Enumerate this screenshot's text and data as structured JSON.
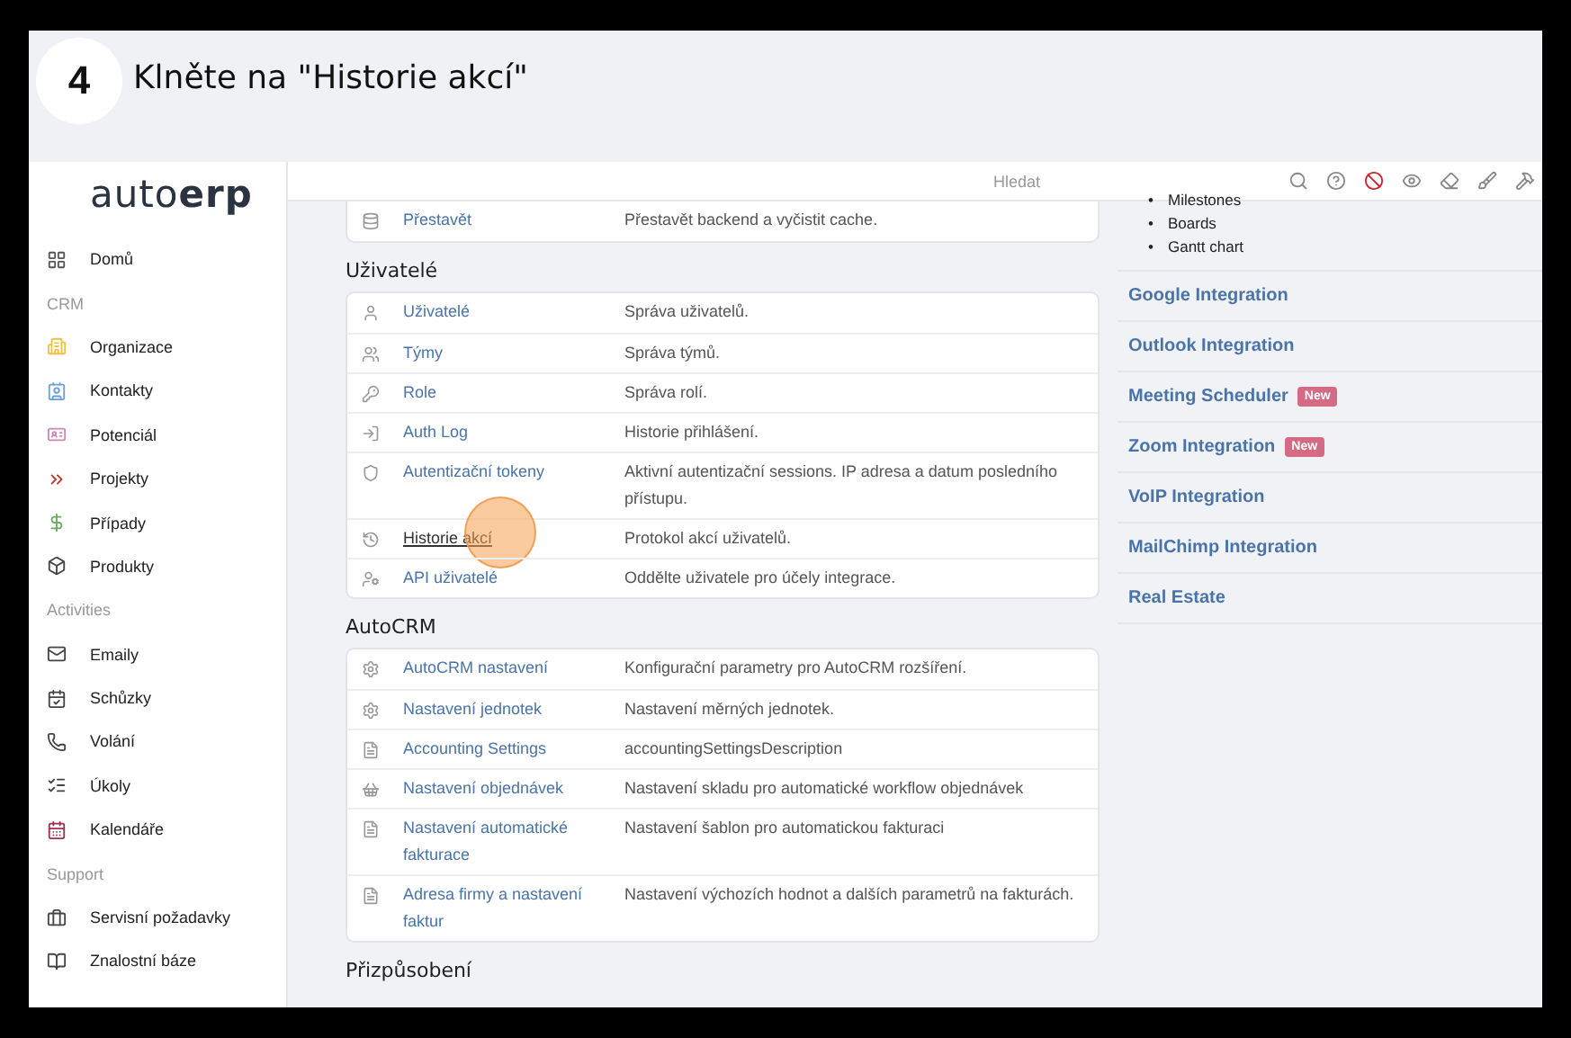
{
  "banner": {
    "step": "4",
    "title": "Klněte na \"Historie akcí\""
  },
  "sidebar": {
    "logo": {
      "light": "auto",
      "bold": "erp"
    },
    "items": [
      {
        "kind": "item",
        "label": "Domů"
      },
      {
        "kind": "section",
        "label": "CRM"
      },
      {
        "kind": "item",
        "label": "Organizace"
      },
      {
        "kind": "item",
        "label": "Kontakty"
      },
      {
        "kind": "item",
        "label": "Potenciál"
      },
      {
        "kind": "item",
        "label": "Projekty"
      },
      {
        "kind": "item",
        "label": "Případy"
      },
      {
        "kind": "item",
        "label": "Produkty"
      },
      {
        "kind": "section",
        "label": "Activities"
      },
      {
        "kind": "item",
        "label": "Emaily"
      },
      {
        "kind": "item",
        "label": "Schůzky"
      },
      {
        "kind": "item",
        "label": "Volání"
      },
      {
        "kind": "item",
        "label": "Úkoly"
      },
      {
        "kind": "item",
        "label": "Kalendáře"
      },
      {
        "kind": "section",
        "label": "Support"
      },
      {
        "kind": "item",
        "label": "Servisní požadavky"
      },
      {
        "kind": "item",
        "label": "Znalostní báze"
      }
    ]
  },
  "search": {
    "placeholder": "Hledat"
  },
  "sections": [
    {
      "rows": [
        {
          "label": "Přestavět",
          "description": "Přestavět backend a vyčistit cache.",
          "clicked": false
        }
      ]
    },
    {
      "title": "Uživatelé",
      "rows": [
        {
          "label": "Uživatelé",
          "description": "Správa uživatelů.",
          "clicked": false
        },
        {
          "label": "Týmy",
          "description": "Správa týmů.",
          "clicked": false
        },
        {
          "label": "Role",
          "description": "Správa rolí.",
          "clicked": false
        },
        {
          "label": "Auth Log",
          "description": "Historie přihlášení.",
          "clicked": false
        },
        {
          "label": "Autentizační tokeny",
          "description": "Aktivní autentizační sessions. IP adresa a datum posledního přístupu.",
          "clicked": false
        },
        {
          "label": "Historie akcí",
          "description": "Protokol akcí uživatelů.",
          "clicked": true
        },
        {
          "label": "API uživatelé",
          "description": "Oddělte uživatele pro účely integrace.",
          "clicked": false
        }
      ]
    },
    {
      "title": "AutoCRM",
      "rows": [
        {
          "label": "AutoCRM nastavení",
          "description": "Konfigurační parametry pro AutoCRM rozšíření.",
          "clicked": false
        },
        {
          "label": "Nastavení jednotek",
          "description": "Nastavení měrných jednotek.",
          "clicked": false
        },
        {
          "label": "Accounting Settings",
          "description": "accountingSettingsDescription",
          "clicked": false
        },
        {
          "label": "Nastavení objednávek",
          "description": "Nastavení skladu pro automatické workflow objednávek",
          "clicked": false
        },
        {
          "label": "Nastavení automatické fakturace",
          "description": "Nastavení šablon pro automatickou fakturaci",
          "clicked": false
        },
        {
          "label": "Adresa firmy a nastavení faktur",
          "description": "Nastavení výchozích hodnot a dalších parametrů na fakturách.",
          "clicked": false
        }
      ]
    },
    {
      "title": "Přizpůsobení"
    }
  ],
  "features": [
    {
      "bullet": "•",
      "label": "Milestones"
    },
    {
      "bullet": "•",
      "label": "Boards"
    },
    {
      "bullet": "•",
      "label": "Gantt chart"
    }
  ],
  "integrations": [
    {
      "label": "Google Integration"
    },
    {
      "label": "Outlook Integration"
    },
    {
      "label": "Meeting Scheduler",
      "badge": "New"
    },
    {
      "label": "Zoom Integration",
      "badge": "New"
    },
    {
      "label": "VoIP Integration"
    },
    {
      "label": "MailChimp Integration"
    },
    {
      "label": "Real Estate"
    }
  ]
}
